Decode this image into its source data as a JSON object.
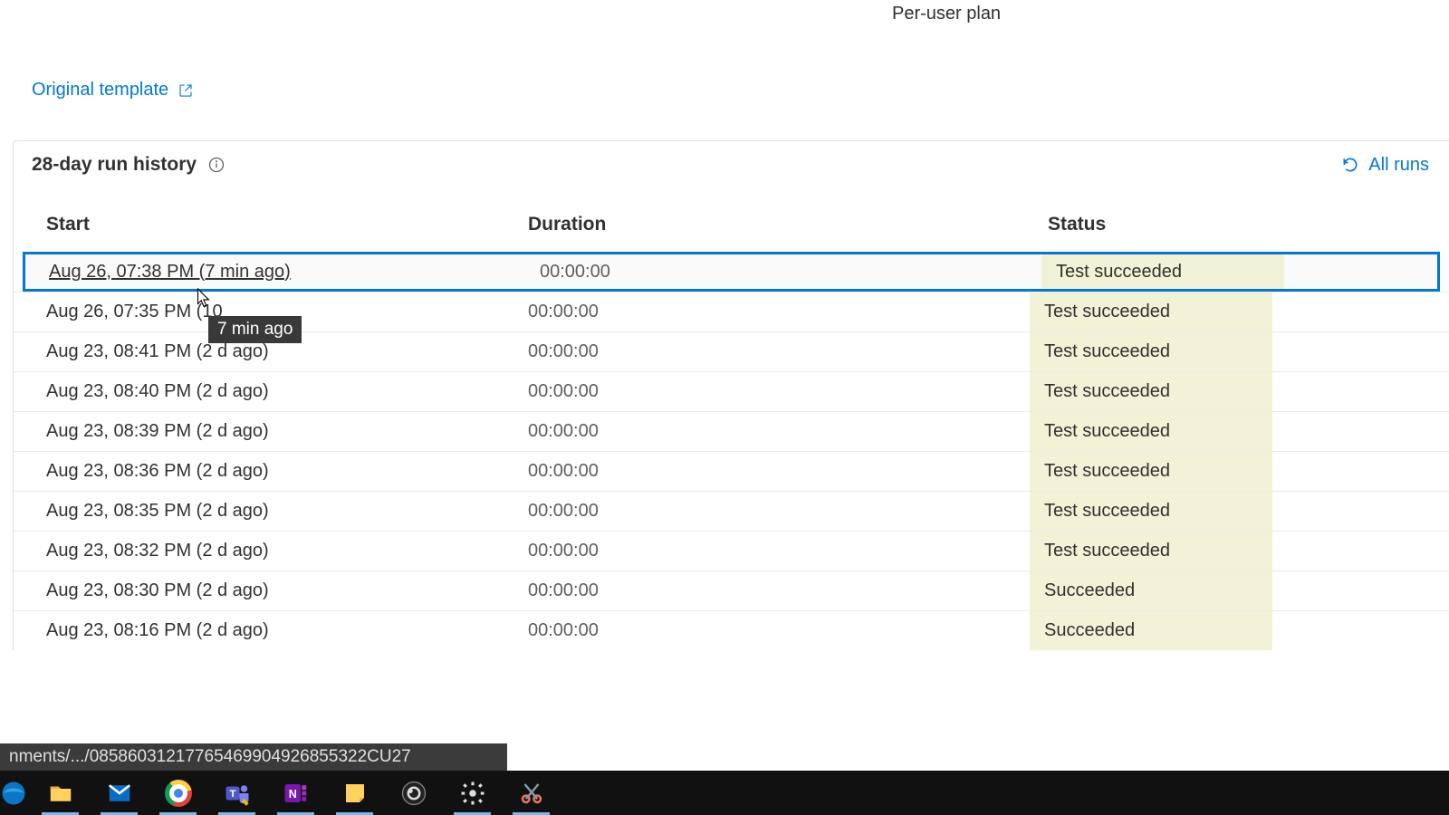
{
  "top": {
    "plan": "Per-user plan",
    "original_template": "Original template"
  },
  "history": {
    "title": "28-day run history",
    "all_runs": "All runs",
    "columns": {
      "start": "Start",
      "duration": "Duration",
      "status": "Status"
    },
    "rows": [
      {
        "start": "Aug 26, 07:38 PM (7 min ago)",
        "duration": "00:00:00",
        "status": "Test succeeded",
        "selected": true
      },
      {
        "start": "Aug 26, 07:35 PM (10",
        "duration": "00:00:00",
        "status": "Test succeeded"
      },
      {
        "start": "Aug 23, 08:41 PM (2 d ago)",
        "duration": "00:00:00",
        "status": "Test succeeded"
      },
      {
        "start": "Aug 23, 08:40 PM (2 d ago)",
        "duration": "00:00:00",
        "status": "Test succeeded"
      },
      {
        "start": "Aug 23, 08:39 PM (2 d ago)",
        "duration": "00:00:00",
        "status": "Test succeeded"
      },
      {
        "start": "Aug 23, 08:36 PM (2 d ago)",
        "duration": "00:00:00",
        "status": "Test succeeded"
      },
      {
        "start": "Aug 23, 08:35 PM (2 d ago)",
        "duration": "00:00:00",
        "status": "Test succeeded"
      },
      {
        "start": "Aug 23, 08:32 PM (2 d ago)",
        "duration": "00:00:00",
        "status": "Test succeeded"
      },
      {
        "start": "Aug 23, 08:30 PM (2 d ago)",
        "duration": "00:00:00",
        "status": "Succeeded"
      },
      {
        "start": "Aug 23, 08:16 PM (2 d ago)",
        "duration": "00:00:00",
        "status": "Succeeded"
      }
    ]
  },
  "tooltip": "7 min ago",
  "statusbar": "nments/.../08586031217765469904926855322CU27",
  "taskbar_items": [
    "edge",
    "explorer",
    "mail",
    "chrome",
    "teams",
    "onenote",
    "stickynotes",
    "obs",
    "settings",
    "snip"
  ]
}
